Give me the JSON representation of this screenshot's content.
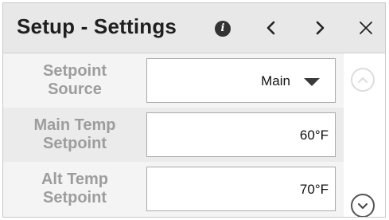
{
  "header": {
    "title": "Setup - Settings",
    "info_icon": "info-icon",
    "prev_icon": "chevron-left-icon",
    "next_icon": "chevron-right-icon",
    "close_icon": "close-icon"
  },
  "settings": [
    {
      "label": "Setpoint Source",
      "value": "Main",
      "control": "dropdown"
    },
    {
      "label": "Main Temp Setpoint",
      "value": "60°F",
      "control": "numeric"
    },
    {
      "label": "Alt Temp Setpoint",
      "value": "70°F",
      "control": "numeric"
    }
  ],
  "scroll": {
    "up_icon": "chevron-up-icon",
    "down_icon": "chevron-down-icon",
    "up_enabled": false,
    "down_enabled": true
  },
  "colors": {
    "header_bg": "#e8e8e8",
    "label_text": "#9d9d9d",
    "title_text": "#1f1f1f"
  }
}
